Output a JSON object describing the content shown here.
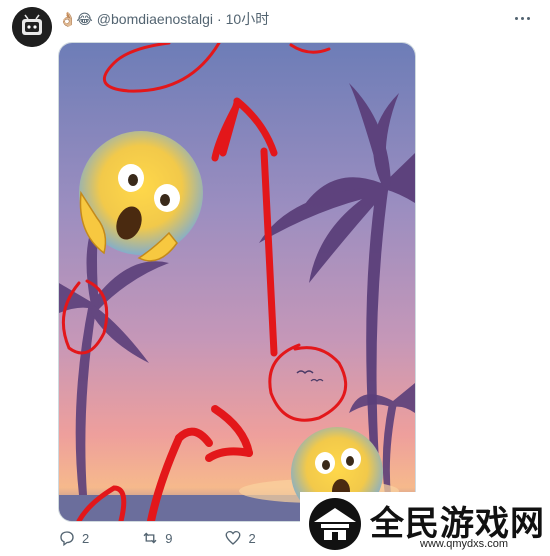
{
  "post": {
    "author_emojis": "👌🏼😂",
    "handle": "@bomdiaenostalgi",
    "separator": "·",
    "time": "10小时"
  },
  "actions": {
    "replies": "2",
    "reposts": "9",
    "likes": "2"
  },
  "watermark": {
    "text": "全民游戏网",
    "url": "www.qmydxs.com"
  },
  "media": {
    "description_colors": {
      "sky_top": "#6f7fb8",
      "sky_mid": "#a58fbd",
      "sky_low": "#e7a1a6",
      "horizon": "#f4b08b",
      "sea": "#6b6f9e",
      "palm": "#5a3f78",
      "scribble": "#e11a1a"
    }
  }
}
